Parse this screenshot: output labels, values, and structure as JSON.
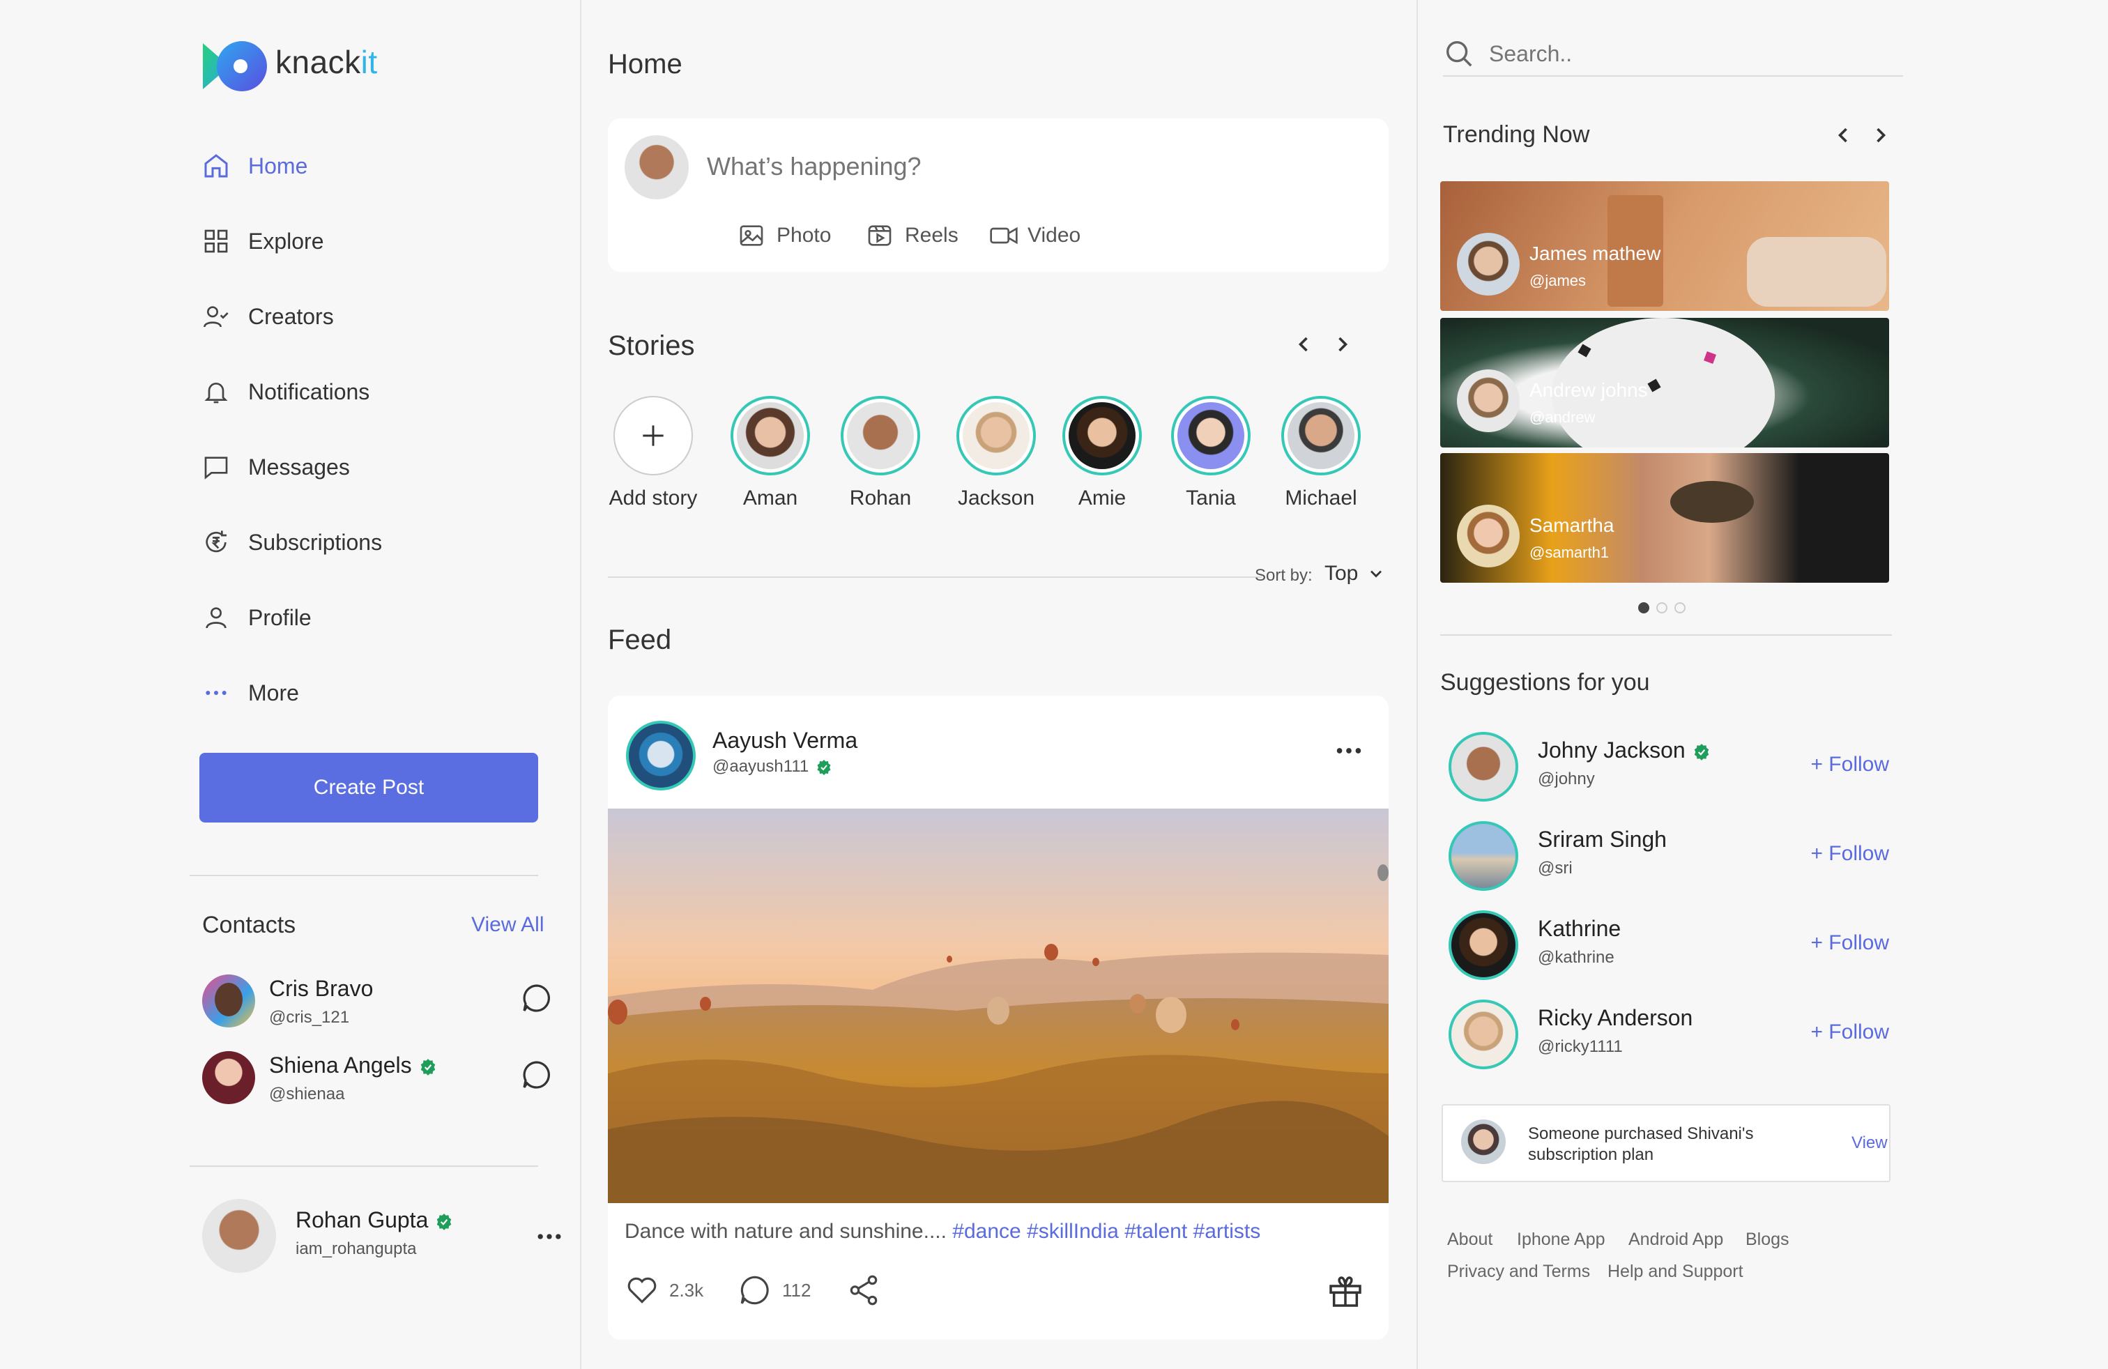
{
  "brand": {
    "name_main": "knack",
    "name_accent": "it"
  },
  "nav": [
    {
      "label": "Home",
      "icon": "home-icon",
      "active": true
    },
    {
      "label": "Explore",
      "icon": "grid-icon"
    },
    {
      "label": "Creators",
      "icon": "user-check-icon"
    },
    {
      "label": "Notifications",
      "icon": "bell-icon"
    },
    {
      "label": "Messages",
      "icon": "chat-icon"
    },
    {
      "label": "Subscriptions",
      "icon": "subscription-icon"
    },
    {
      "label": "Profile",
      "icon": "person-icon"
    },
    {
      "label": "More",
      "icon": "ellipsis-icon"
    }
  ],
  "create_post": "Create Post",
  "contacts": {
    "title": "Contacts",
    "view_all": "View All",
    "items": [
      {
        "name": "Cris Bravo",
        "handle": "@cris_121",
        "verified": false
      },
      {
        "name": "Shiena Angels",
        "handle": "@shienaa",
        "verified": true
      }
    ]
  },
  "current_user": {
    "name": "Rohan Gupta",
    "handle": "iam_rohangupta",
    "verified": true
  },
  "main": {
    "title": "Home",
    "composer": {
      "placeholder": "What’s happening?",
      "actions": [
        "Photo",
        "Reels",
        "Video"
      ]
    },
    "stories": {
      "title": "Stories",
      "add_label": "Add story",
      "people": [
        "Aman",
        "Rohan",
        "Jackson",
        "Amie",
        "Tania",
        "Michael"
      ]
    },
    "sort": {
      "label": "Sort by:",
      "value": "Top"
    },
    "feed": {
      "title": "Feed",
      "post": {
        "author": "Aayush Verma",
        "handle": "@aayush111",
        "verified": true,
        "caption": "Dance with nature and sunshine....",
        "tags": "#dance #skillIndia #talent #artists",
        "likes": "2.3k",
        "comments": "112"
      }
    }
  },
  "search": {
    "placeholder": "Search.."
  },
  "trending": {
    "title": "Trending Now",
    "items": [
      {
        "name": "James mathew",
        "handle": "@james"
      },
      {
        "name": "Andrew johns",
        "handle": "@andrew"
      },
      {
        "name": "Samartha",
        "handle": "@samarth1"
      }
    ]
  },
  "suggestions": {
    "title": "Suggestions for you",
    "follow_label": "+ Follow",
    "items": [
      {
        "name": "Johny Jackson",
        "handle": "@johny",
        "verified": true
      },
      {
        "name": "Sriram Singh",
        "handle": "@sri",
        "verified": false
      },
      {
        "name": "Kathrine",
        "handle": "@kathrine",
        "verified": false
      },
      {
        "name": "Ricky Anderson",
        "handle": "@ricky1111",
        "verified": false
      }
    ]
  },
  "notice": {
    "line1": "Someone purchased Shivani's",
    "line2": "subscription plan",
    "action": "View"
  },
  "footer": [
    "About",
    "Iphone App",
    "Android App",
    "Blogs",
    "Privacy and Terms",
    "Help and Support"
  ],
  "colors": {
    "accent": "#5b6ee1",
    "teal": "#36c8b6",
    "verified": "#1e9e5a"
  }
}
